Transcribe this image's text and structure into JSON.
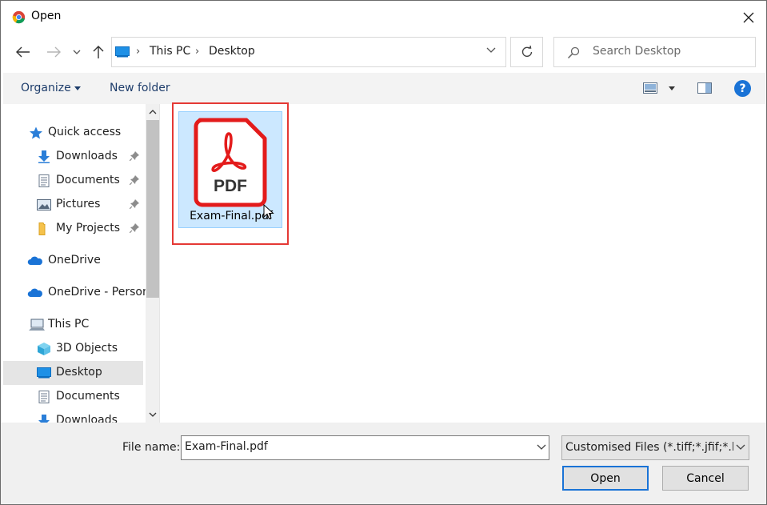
{
  "window": {
    "title": "Open"
  },
  "address": {
    "crumbs": [
      "This PC",
      "Desktop"
    ]
  },
  "search": {
    "placeholder": "Search Desktop"
  },
  "toolbar": {
    "organize_label": "Organize",
    "new_folder_label": "New folder",
    "help_label": "?"
  },
  "sidebar": {
    "items": [
      {
        "label": "Quick access",
        "icon": "star-icon"
      },
      {
        "label": "Downloads",
        "icon": "download-icon",
        "pinned": true
      },
      {
        "label": "Documents",
        "icon": "document-icon",
        "pinned": true
      },
      {
        "label": "Pictures",
        "icon": "pictures-icon",
        "pinned": true
      },
      {
        "label": "My Projects",
        "icon": "folder-icon",
        "pinned": true
      },
      {
        "label": "OneDrive",
        "icon": "cloud-icon"
      },
      {
        "label": "OneDrive - Person",
        "icon": "cloud-icon"
      },
      {
        "label": "This PC",
        "icon": "computer-icon"
      },
      {
        "label": "3D Objects",
        "icon": "cube-icon"
      },
      {
        "label": "Desktop",
        "icon": "desktop-icon",
        "selected": true
      },
      {
        "label": "Documents",
        "icon": "document-icon"
      },
      {
        "label": "Downloads",
        "icon": "download-icon"
      }
    ]
  },
  "files": [
    {
      "name": "Exam-Final.pdf",
      "icon_text": "PDF",
      "selected": true
    }
  ],
  "footer": {
    "file_name_label": "File name:",
    "file_name_value": "Exam-Final.pdf",
    "file_type": "Customised Files (*.tiff;*.jfif;*.bmp",
    "open_label": "Open",
    "cancel_label": "Cancel"
  },
  "colors": {
    "accent": "#1a73d6",
    "selection": "#cce8ff",
    "highlight": "#e53935",
    "pdf_red": "#e31b1b"
  }
}
